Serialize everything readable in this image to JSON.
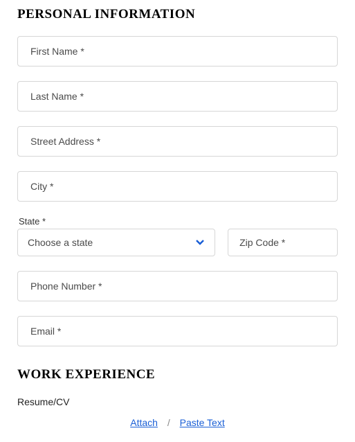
{
  "sections": {
    "personal_info_title": "PERSONAL INFORMATION",
    "work_experience_title": "WORK EXPERIENCE"
  },
  "fields": {
    "first_name_placeholder": "First Name *",
    "last_name_placeholder": "Last Name *",
    "street_address_placeholder": "Street Address *",
    "city_placeholder": "City *",
    "state_label": "State *",
    "state_select_text": "Choose a state",
    "zip_placeholder": "Zip Code *",
    "phone_placeholder": "Phone Number *",
    "email_placeholder": "Email *"
  },
  "resume": {
    "label": "Resume/CV",
    "attach_text": "Attach",
    "divider": "/",
    "paste_text": "Paste Text"
  }
}
